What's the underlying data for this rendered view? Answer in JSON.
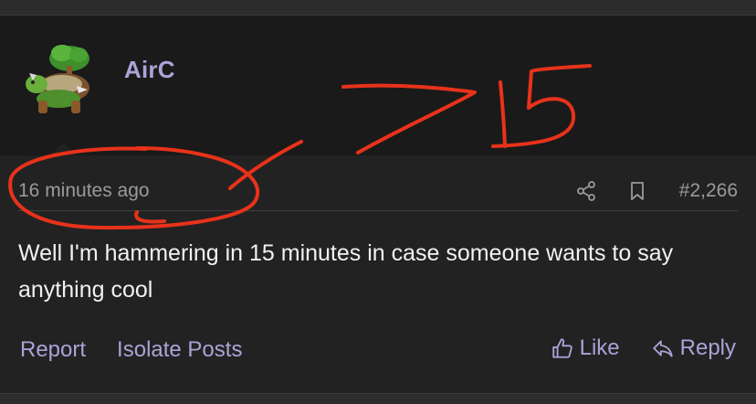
{
  "post": {
    "username": "AirC",
    "timestamp": "16 minutes ago",
    "post_number": "#2,266",
    "message": "Well I'm hammering in 15 minutes in case someone wants to say anything cool"
  },
  "actions": {
    "report": "Report",
    "isolate": "Isolate Posts",
    "like": "Like",
    "reply": "Reply"
  },
  "icons": {
    "share": "share-icon",
    "bookmark": "bookmark-icon",
    "like": "thumbs-up-icon",
    "reply": "reply-arrow-icon"
  },
  "colors": {
    "accent": "#a9a4d8",
    "annotation": "#e8321a"
  }
}
